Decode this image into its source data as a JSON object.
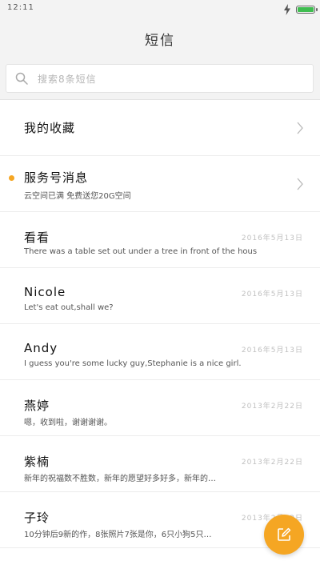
{
  "status_bar": {
    "time": "12:11",
    "icons": [
      "charging-icon",
      "battery-icon"
    ],
    "battery_level": 1.0,
    "battery_color": "#3fbd50"
  },
  "header": {
    "title": "短信"
  },
  "search": {
    "placeholder": "搜索8条短信"
  },
  "colors": {
    "accent": "#f5a623",
    "unread_dot": "#f5a623",
    "background": "#f3f3f3"
  },
  "list": {
    "favorites": {
      "label": "我的收藏"
    },
    "service": {
      "title": "服务号消息",
      "preview": "云空间已满 免费送您20G空间"
    },
    "messages": [
      {
        "name": "看看",
        "date": "2016年5月13日",
        "preview": "There was a table set out under a tree in front of the hous"
      },
      {
        "name": "Nicole",
        "date": "2016年5月13日",
        "preview": "Let's eat out,shall we?"
      },
      {
        "name": "Andy",
        "date": "2016年5月13日",
        "preview": "I guess you're some lucky guy,Stephanie is a nice girl."
      },
      {
        "name": "燕婷",
        "date": "2013年2月22日",
        "preview": "嗯，收到啦，谢谢谢谢。"
      },
      {
        "name": "紫楠",
        "date": "2013年2月22日",
        "preview": "新年的祝福数不胜数，新年的愿望好多好多，新年的…"
      },
      {
        "name": "子玲",
        "date": "2013年2月22日",
        "preview": "10分钟后9新的作，8张照片7张是你，6只小狗5只…"
      }
    ]
  },
  "fab": {
    "icon": "compose-icon",
    "color": "#f5a623"
  }
}
